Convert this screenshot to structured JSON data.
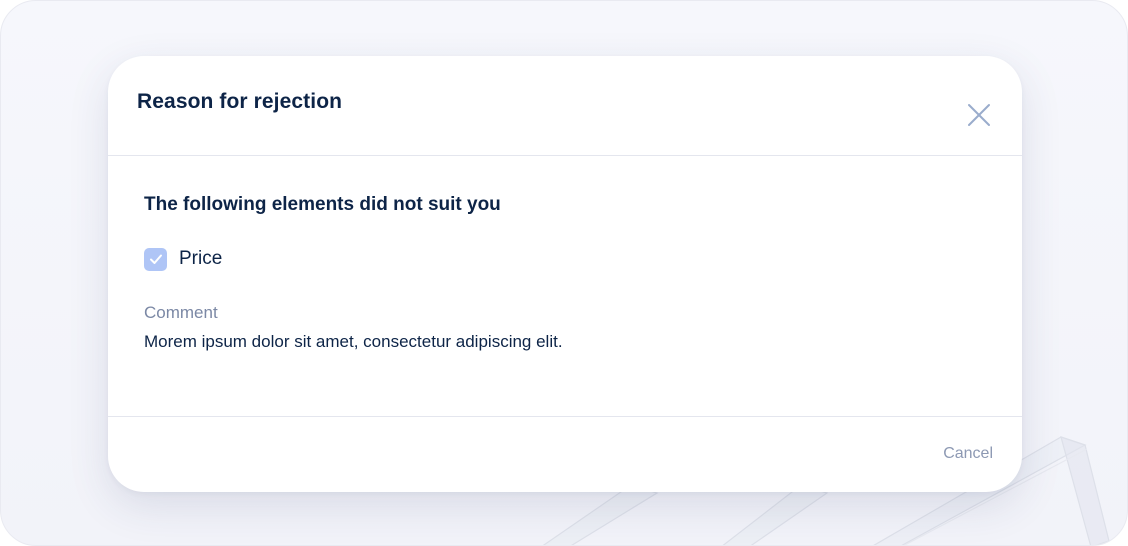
{
  "modal": {
    "title": "Reason for rejection",
    "close_icon": "close-icon"
  },
  "body": {
    "heading": "The following elements did not suit you",
    "options": [
      {
        "label": "Price",
        "checked": true
      }
    ],
    "comment_label": "Comment",
    "comment_text": "Morem ipsum dolor sit amet, consectetur adipiscing elit."
  },
  "footer": {
    "cancel_label": "Cancel"
  },
  "colors": {
    "title_text": "#0d2447",
    "muted_text": "#7b88a5",
    "checkbox_fill": "#afc5f6",
    "close_icon": "#9aaccc",
    "divider": "#e4e6ee",
    "backdrop": "#f4f5fb"
  }
}
